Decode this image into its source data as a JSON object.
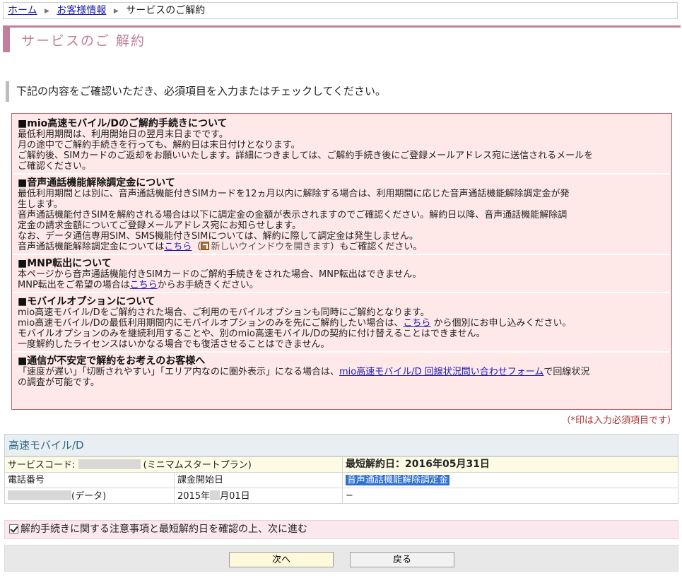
{
  "breadcrumb": {
    "home": "ホーム",
    "customer": "お客様情報",
    "current": "サービスのご解約"
  },
  "page": {
    "title": "サービスのご 解約",
    "intro": "下記の内容をご確認いただき、必須項目を入力またはチェックしてください。"
  },
  "notice": {
    "s1": {
      "head": "■mio高速モバイル/Dのご解約手続きについて",
      "l1": "最低利用期間は、利用開始日の翌月末日までです。",
      "l2": "月の途中でご解約手続きを行っても、解約日は末日付けとなります。",
      "l3": "ご解約後、SIMカードのご返却をお願いいたします。詳細につきましては、ご解約手続き後にご登録メールアドレス宛に送信されるメールを",
      "l4": "ご確認ください。"
    },
    "s2": {
      "head": "■音声通話機能解除調定金について",
      "l1": "最低利用期間とは別に、音声通話機能付きSIMカードを12ヵ月以内に解除する場合は、利用期間に応じた音声通話機能解除調定金が発",
      "l2": "生します。",
      "l3": "音声通話機能付きSIMを解約される場合は以下に調定金の金額が表示されますのでご確認ください。解約日以降、音声通話機能解除調",
      "l4": "定金の請求金額についてご登録メールアドレス宛にお知らせします。",
      "l5": "なお、データ通信専用SIM、SMS機能付きSIMについては、解約に際して調定金は発生しません。",
      "l6a": "音声通話機能解除調定金については",
      "l6link": "こちら",
      "l6paren": "（",
      "l6newwin": "新しいウインドウを開きます",
      "l6b": "）もご確認ください。"
    },
    "s3": {
      "head": "■MNP転出について",
      "l1": "本ページから音声通話機能付きSIMカードのご解約手続きをされた場合、MNP転出はできません。",
      "l2a": "MNP転出をご希望の場合は",
      "l2link": "こちら",
      "l2b": "からお手続きください。"
    },
    "s4": {
      "head": "■モバイルオプションについて",
      "l1": "mio高速モバイル/Dをご解約された場合、ご利用のモバイルオプションも同時にご解約となります。",
      "l2a": "mio高速モバイル/Dの最低利用期間内にモバイルオプションのみを先にご解約したい場合は、",
      "l2link": "こちら",
      "l2b": " から個別にお申し込みください。",
      "l3": "モバイルオプションのみを継続利用することや、別のmio高速モバイル/Dの契約に付け替えることはできません。",
      "l4": "一度解約したライセンスはいかなる場合でも復活させることはできません。"
    },
    "s5": {
      "head": "■通信が不安定で解約をお考えのお客様へ",
      "l1a": "「速度が遅い」「切断されやすい」「エリア内なのに圏外表示」になる場合は、",
      "l1link": "mio高速モバイル/D 回線状況問い合わせフォーム",
      "l1b": "で回線状況",
      "l2": "の調査が可能です。"
    }
  },
  "required_note": "（*印は入力必須項目です）",
  "service": {
    "header": "高速モバイル/D",
    "code_label": "サービスコード:",
    "plan": "(ミニマムスタートプラン)",
    "min_cancel": "最短解約日：2016年05月31日",
    "col_phone": "電話番号",
    "col_start": "課金開始日",
    "col_fee": "音声通話機能解除調定金",
    "row_type": "(データ)",
    "row_year": "2015年",
    "row_day": "月01日",
    "row_fee": "−"
  },
  "confirm": {
    "label": "解約手続きに関する注意事項と最短解約日を確認の上、次に進む",
    "checked": true
  },
  "buttons": {
    "next": "次へ",
    "back": "戻る"
  }
}
